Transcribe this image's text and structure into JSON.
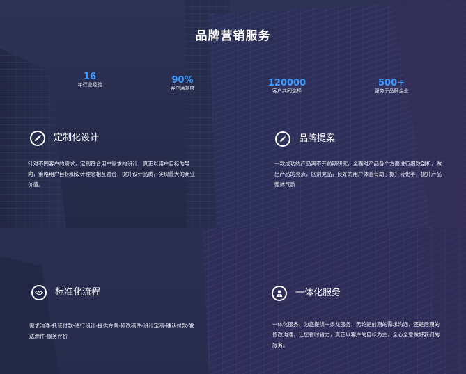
{
  "header": {
    "title": "品牌营销服务"
  },
  "stats": [
    {
      "value": "16",
      "label": "年行业经验"
    },
    {
      "value": "90%",
      "label": "客户满意度"
    },
    {
      "value": "120000",
      "label": "客户共同选择"
    },
    {
      "value": "500+",
      "label": "服务于品牌企业"
    }
  ],
  "features": [
    {
      "icon": "pencil-icon",
      "title": "定制化设计",
      "desc": "针对不同客户的需求，定制符合用户需求的设计，真正以用户目标为导向，策略用户目标和设计理念相互融合，提升设计品质，实现最大的商业价值。"
    },
    {
      "icon": "pencil-icon",
      "title": "品牌提案",
      "desc": "一款成功的产品离不开前期研究，全面对产品各个方面进行细致剖析，做出产品的亮点，区别竞品，良好的用户体验有助于提升转化率，提升产品整体气质"
    },
    {
      "icon": "handshake-icon",
      "title": "标准化流程",
      "desc": "需求沟通-托管付款-进行设计-提供方案-修改稿件-设计定稿-确认付款-发送源件-服务评价"
    },
    {
      "icon": "user-icon",
      "title": "一体化服务",
      "desc": "一体化服务，为您提供一条龙服务，无论是前期的需求沟通，还是后期的修改沟通，让您省时省力，真正以客户的目标为主，全心全意做好我们的服务。"
    }
  ],
  "colors": {
    "background": "#2b2f52",
    "accent": "#3d9bff"
  }
}
